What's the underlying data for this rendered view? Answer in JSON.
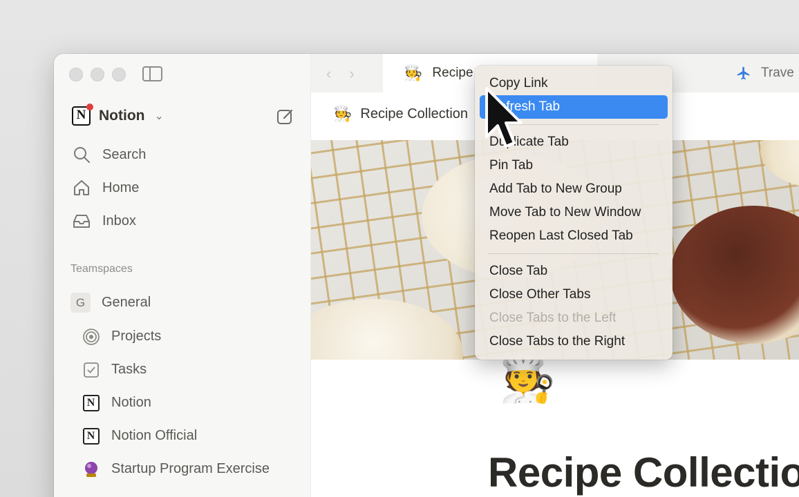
{
  "sidebar": {
    "workspace": {
      "name": "Notion",
      "logo_letter": "N"
    },
    "nav": [
      {
        "label": "Search",
        "icon": "search-icon"
      },
      {
        "label": "Home",
        "icon": "home-icon"
      },
      {
        "label": "Inbox",
        "icon": "inbox-icon"
      }
    ],
    "teamspaces_label": "Teamspaces",
    "teamspace": {
      "letter": "G",
      "name": "General"
    },
    "pages": [
      {
        "label": "Projects",
        "icon": "target-icon"
      },
      {
        "label": "Tasks",
        "icon": "checkbox-icon"
      },
      {
        "label": "Notion",
        "icon": "notion-logo-icon"
      },
      {
        "label": "Notion Official",
        "icon": "notion-logo-icon"
      },
      {
        "label": "Startup Program Exercise",
        "icon": "crystal-ball-icon"
      }
    ]
  },
  "tabs": {
    "active": {
      "label": "Recipe",
      "icon": "chef-emoji"
    },
    "other": {
      "label": "Trave",
      "icon": "airplane-icon"
    }
  },
  "breadcrumb": {
    "label": "Recipe Collection",
    "icon": "chef-emoji"
  },
  "page": {
    "title": "Recipe Collectio",
    "emoji": "🧑‍🍳"
  },
  "context_menu": {
    "group1": [
      {
        "label": "Copy Link"
      },
      {
        "label": "Refresh Tab",
        "highlighted": true
      }
    ],
    "group2": [
      {
        "label": "Duplicate Tab"
      },
      {
        "label": "Pin Tab"
      },
      {
        "label": "Add Tab to New Group"
      },
      {
        "label": "Move Tab to New Window"
      },
      {
        "label": "Reopen Last Closed Tab"
      }
    ],
    "group3": [
      {
        "label": "Close Tab"
      },
      {
        "label": "Close Other Tabs"
      },
      {
        "label": "Close Tabs to the Left",
        "disabled": true
      },
      {
        "label": "Close Tabs to the Right"
      }
    ]
  },
  "colors": {
    "menu_highlight": "#3a8af2",
    "notification_dot": "#e03e3e"
  }
}
